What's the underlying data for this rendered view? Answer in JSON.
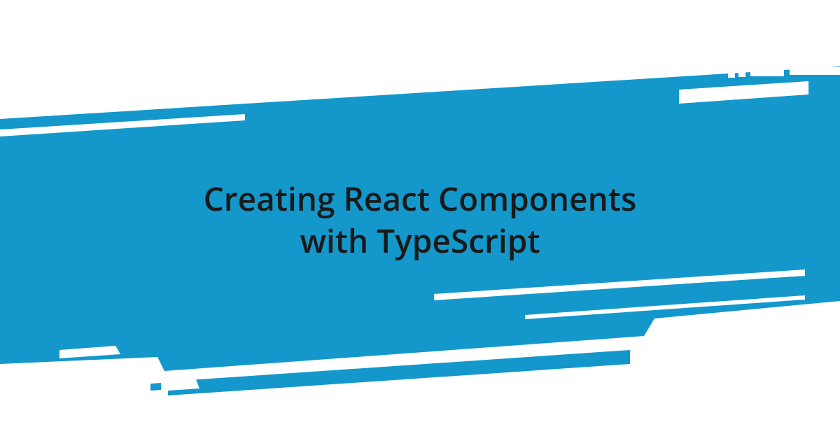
{
  "banner": {
    "title_line1": "Creating React Components",
    "title_line2": "with TypeScript",
    "accent_color": "#1498cb",
    "text_color": "#1a1a1a",
    "background_color": "#ffffff"
  }
}
